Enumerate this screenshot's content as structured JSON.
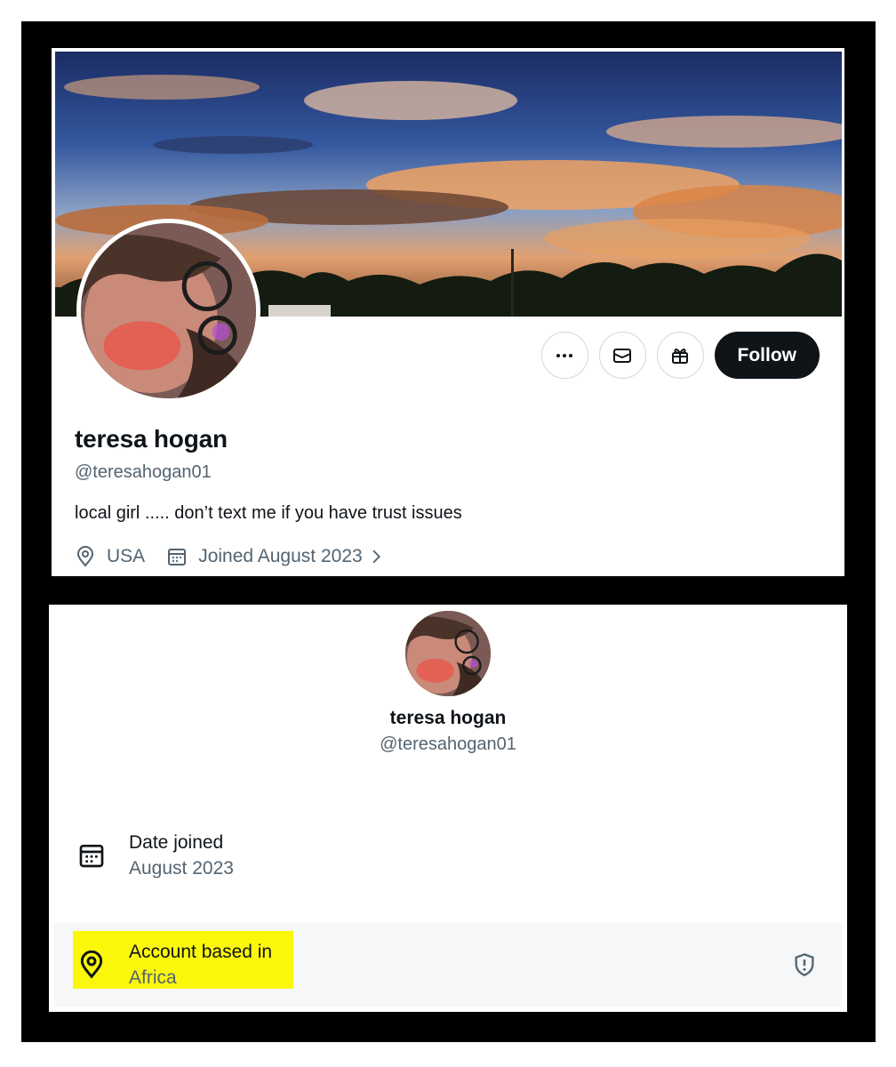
{
  "profile": {
    "display_name": "teresa hogan",
    "handle": "@teresahogan01",
    "bio": "local girl ..... don’t text me if you have trust issues",
    "location": "USA",
    "joined": "Joined August 2023",
    "follow_label": "Follow"
  },
  "about": {
    "display_name": "teresa hogan",
    "handle": "@teresahogan01",
    "date_joined_label": "Date joined",
    "date_joined_value": "August 2023",
    "based_in_label": "Account based in",
    "based_in_value": "Africa"
  },
  "icons": {
    "more": "more-icon",
    "message": "envelope-icon",
    "gift": "gift-icon",
    "location": "location-pin-icon",
    "calendar": "calendar-icon",
    "chevron": "chevron-right-icon",
    "shield": "shield-alert-icon"
  },
  "colors": {
    "highlight": "#fbf70b",
    "follow_bg": "#0f1419",
    "secondary_text": "#536471",
    "frame": "#000000"
  }
}
